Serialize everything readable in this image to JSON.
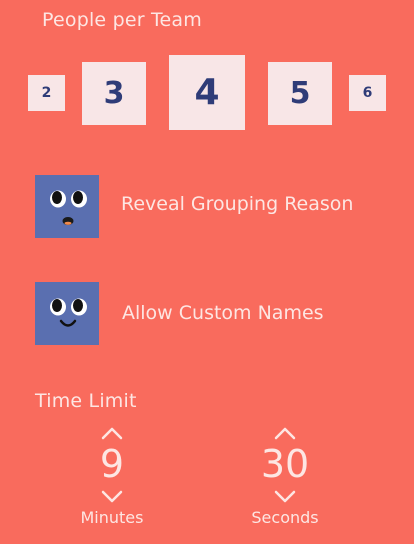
{
  "team_size": {
    "label": "People per Team",
    "options": [
      "2",
      "3",
      "4",
      "5",
      "6"
    ],
    "selected": "4"
  },
  "options": [
    {
      "label": "Reveal Grouping Reason",
      "avatar": "surprised-face-icon"
    },
    {
      "label": "Allow Custom Names",
      "avatar": "smiling-face-icon"
    }
  ],
  "time_limit": {
    "label": "Time Limit",
    "minutes": {
      "value": "9",
      "unit": "Minutes"
    },
    "seconds": {
      "value": "30",
      "unit": "Seconds"
    }
  },
  "colors": {
    "background": "#f96b5d",
    "tile": "#f8e6e7",
    "tile_text": "#2f3c78",
    "avatar": "#5a6fb0"
  }
}
